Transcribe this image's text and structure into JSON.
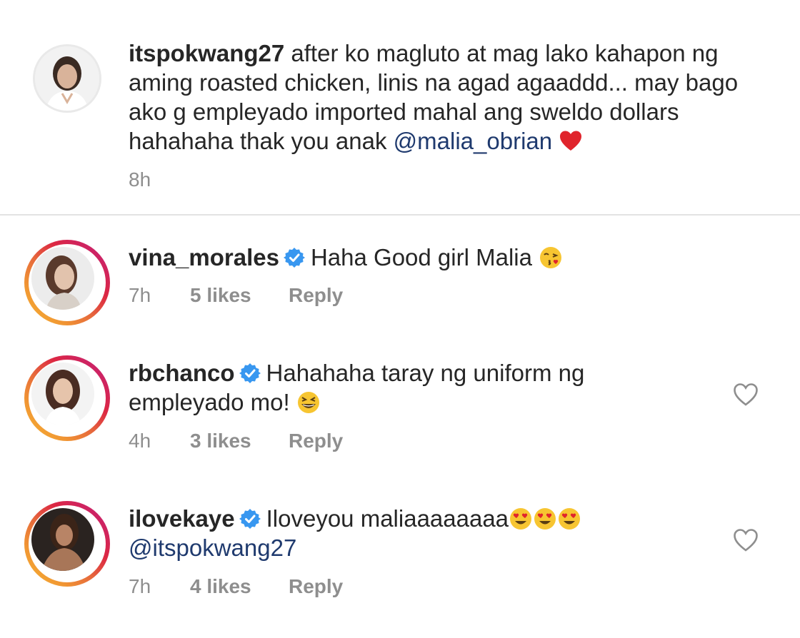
{
  "caption": {
    "username": "itspokwang27",
    "text": "after ko magluto at mag lako kahapon ng aming roasted chicken, linis na agad agaaddd... may bago ako g empleyado imported mahal ang sweldo dollars hahahaha thak you anak",
    "mention": "@malia_obrian",
    "emoji": "red-heart",
    "time": "8h"
  },
  "comments": [
    {
      "username": "vina_morales",
      "verified": true,
      "text": "Haha Good girl Malia",
      "emoji": "face-blowing-kiss",
      "time": "7h",
      "likes": "5 likes",
      "reply": "Reply",
      "has_heart": false
    },
    {
      "username": "rbchanco",
      "verified": true,
      "text_line1": "Hahahaha taray ng uniform ng",
      "text_line2": "empleyado mo!",
      "emoji": "grinning-squinting-face",
      "time": "4h",
      "likes": "3 likes",
      "reply": "Reply",
      "has_heart": true
    },
    {
      "username": "ilovekaye",
      "verified": true,
      "text": "Iloveyou maliaaaaaaaa",
      "emoji": "heart-eyes x3",
      "mention": "@itspokwang27",
      "time": "7h",
      "likes": "4 likes",
      "reply": "Reply",
      "has_heart": true
    }
  ],
  "colors": {
    "text": "#262626",
    "muted": "#8e8e8e",
    "mention": "#1f3a6e",
    "verified": "#3897f0",
    "heart": "#ed4956",
    "divider": "#e3e3e3"
  }
}
